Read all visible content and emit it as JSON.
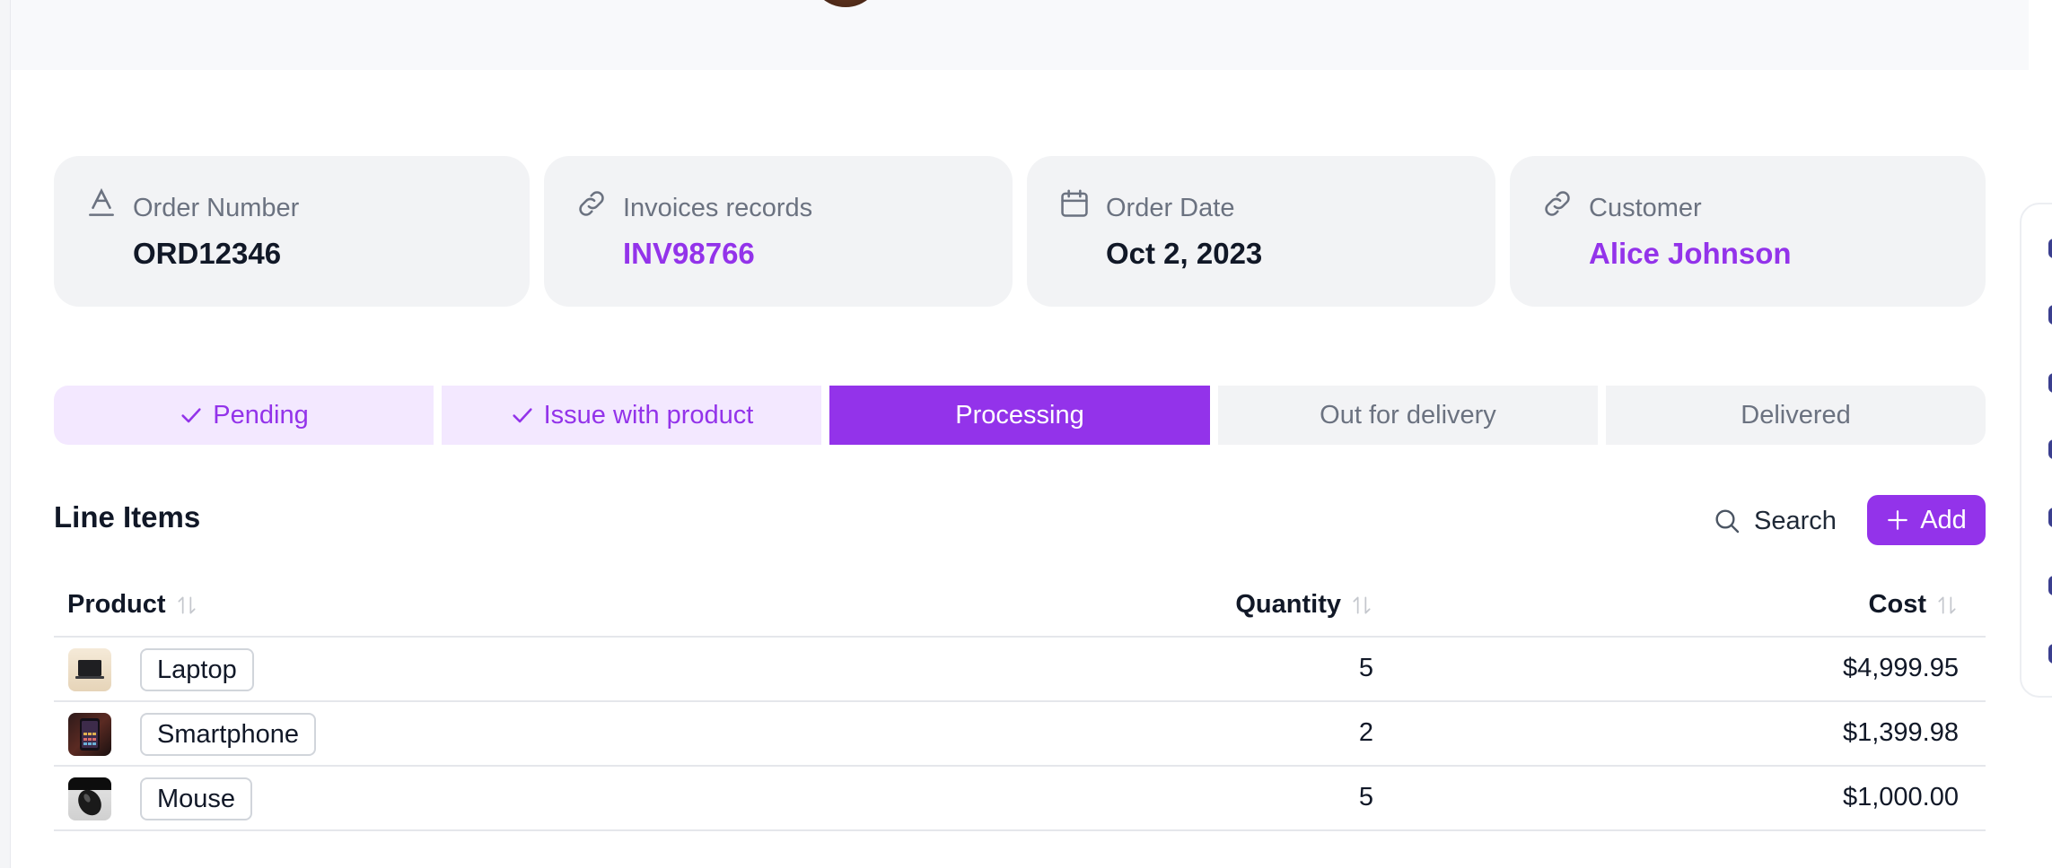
{
  "order": {
    "number_label": "Order Number",
    "number_value": "ORD12346",
    "invoice_label": "Invoices records",
    "invoice_value": "INV98766",
    "date_label": "Order Date",
    "date_value": "Oct 2, 2023",
    "customer_label": "Customer",
    "customer_value": "Alice Johnson"
  },
  "status_steps": [
    {
      "label": "Pending",
      "state": "done"
    },
    {
      "label": "Issue with product",
      "state": "done"
    },
    {
      "label": "Processing",
      "state": "current"
    },
    {
      "label": "Out for delivery",
      "state": "todo"
    },
    {
      "label": "Delivered",
      "state": "todo"
    }
  ],
  "line_items": {
    "title": "Line Items",
    "search_label": "Search",
    "add_label": "Add",
    "columns": {
      "product": "Product",
      "quantity": "Quantity",
      "cost": "Cost"
    },
    "rows": [
      {
        "product": "Laptop",
        "quantity": "5",
        "cost": "$4,999.95",
        "thumb": "laptop-image"
      },
      {
        "product": "Smartphone",
        "quantity": "2",
        "cost": "$1,399.98",
        "thumb": "smartphone-image"
      },
      {
        "product": "Mouse",
        "quantity": "5",
        "cost": "$1,000.00",
        "thumb": "mouse-image"
      }
    ]
  },
  "colors": {
    "accent": "#9333ea",
    "accent_light": "#f3e8ff",
    "card_bg": "#f2f3f5",
    "muted_text": "#6b7280"
  },
  "icons": {
    "order_number": "text-format-icon",
    "invoice": "link-icon",
    "order_date": "calendar-icon",
    "customer": "link-icon",
    "step_done": "check-icon",
    "search": "search-icon",
    "add": "plus-icon",
    "sort": "sort-arrows-icon"
  }
}
